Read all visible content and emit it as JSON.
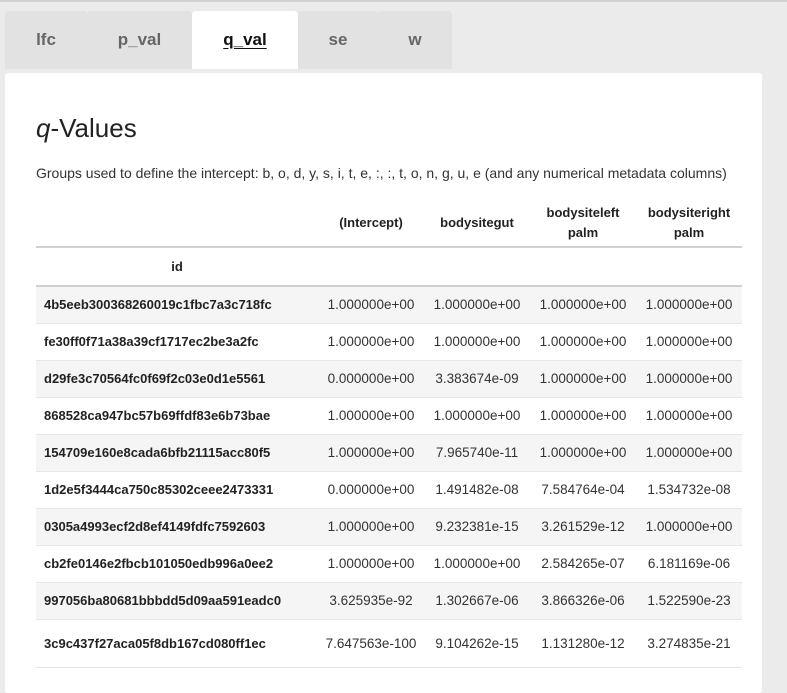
{
  "tabs": [
    {
      "label": "lfc",
      "active": false
    },
    {
      "label": "p_val",
      "active": false
    },
    {
      "label": "q_val",
      "active": true
    },
    {
      "label": "se",
      "active": false
    },
    {
      "label": "w",
      "active": false
    }
  ],
  "title": {
    "italic": "q",
    "rest": "-Values"
  },
  "subtitle": "Groups used to define the intercept: b, o, d, y, s, i, t, e, :, :, t, o, n, g, u, e (and any numerical metadata columns)",
  "table": {
    "columns": [
      "(Intercept)",
      "bodysitegut",
      "bodysiteleft palm",
      "bodysiteright palm"
    ],
    "index_name": "id",
    "rows": [
      {
        "id": "4b5eeb300368260019c1fbc7a3c718fc",
        "values": [
          "1.000000e+00",
          "1.000000e+00",
          "1.000000e+00",
          "1.000000e+00"
        ]
      },
      {
        "id": "fe30ff0f71a38a39cf1717ec2be3a2fc",
        "values": [
          "1.000000e+00",
          "1.000000e+00",
          "1.000000e+00",
          "1.000000e+00"
        ]
      },
      {
        "id": "d29fe3c70564fc0f69f2c03e0d1e5561",
        "values": [
          "0.000000e+00",
          "3.383674e-09",
          "1.000000e+00",
          "1.000000e+00"
        ]
      },
      {
        "id": "868528ca947bc57b69ffdf83e6b73bae",
        "values": [
          "1.000000e+00",
          "1.000000e+00",
          "1.000000e+00",
          "1.000000e+00"
        ]
      },
      {
        "id": "154709e160e8cada6bfb21115acc80f5",
        "values": [
          "1.000000e+00",
          "7.965740e-11",
          "1.000000e+00",
          "1.000000e+00"
        ]
      },
      {
        "id": "1d2e5f3444ca750c85302ceee2473331",
        "values": [
          "0.000000e+00",
          "1.491482e-08",
          "7.584764e-04",
          "1.534732e-08"
        ]
      },
      {
        "id": "0305a4993ecf2d8ef4149fdfc7592603",
        "values": [
          "1.000000e+00",
          "9.232381e-15",
          "3.261529e-12",
          "1.000000e+00"
        ]
      },
      {
        "id": "cb2fe0146e2fbcb101050edb996a0ee2",
        "values": [
          "1.000000e+00",
          "1.000000e+00",
          "2.584265e-07",
          "6.181169e-06"
        ]
      },
      {
        "id": "997056ba80681bbbdd5d09aa591eadc0",
        "values": [
          "3.625935e-92",
          "1.302667e-06",
          "3.866326e-06",
          "1.522590e-23"
        ]
      },
      {
        "id": "3c9c437f27aca05f8db167cd080ff1ec",
        "values": [
          "7.647563e-100",
          "9.104262e-15",
          "1.131280e-12",
          "3.274835e-21"
        ]
      }
    ]
  }
}
